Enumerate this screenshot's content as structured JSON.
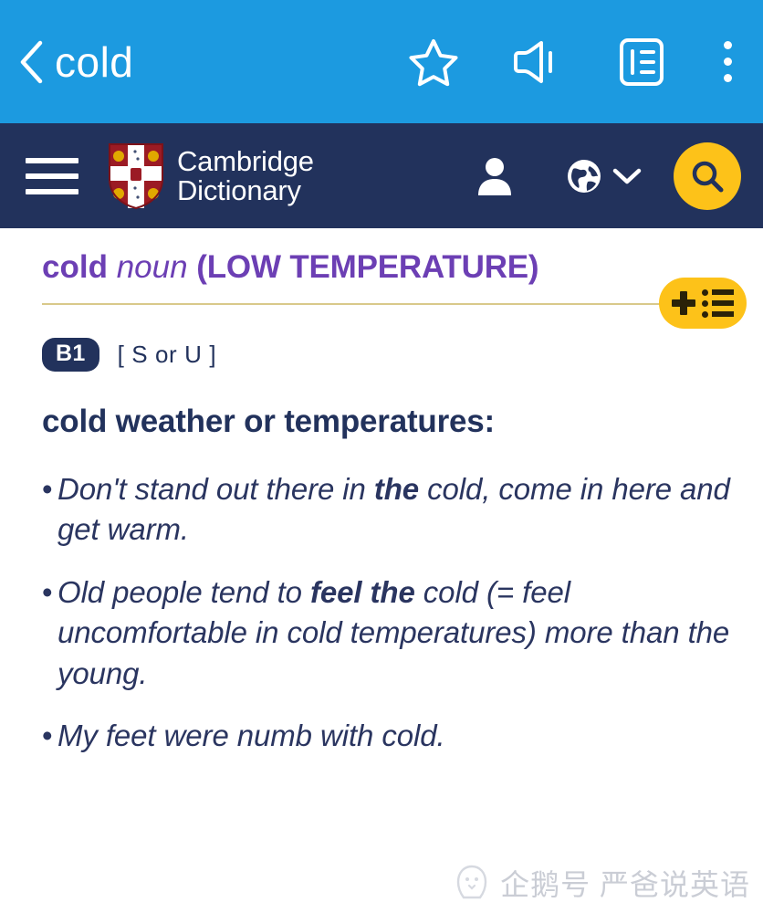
{
  "appbar": {
    "background": "#1c9ae0",
    "back_icon": "chevron-left-icon",
    "title": "cold",
    "icons": [
      {
        "name": "star-icon",
        "label": "Favourite"
      },
      {
        "name": "speaker-icon",
        "label": "Pronounce"
      },
      {
        "name": "article-icon",
        "label": "Article view"
      },
      {
        "name": "more-vertical-icon",
        "label": "More options"
      }
    ]
  },
  "site_header": {
    "background": "#22325c",
    "menu_icon": "hamburger-icon",
    "logo_icon": "cambridge-crest-icon",
    "brand_line1": "Cambridge",
    "brand_line2": "Dictionary",
    "account_icon": "person-icon",
    "language_icon": "globe-icon",
    "language_chevron_icon": "chevron-down-icon",
    "search_icon": "search-icon",
    "search_button_color": "#fdc219"
  },
  "entry": {
    "headword": "cold",
    "part_of_speech": "noun",
    "guide_word": "(LOW TEMPERATURE)",
    "headword_color": "#6c3fb4",
    "add_to_wordlist": {
      "plus_icon": "plus-icon",
      "list_icon": "list-icon",
      "color": "#fdc219"
    },
    "level": "B1",
    "grammar": "[ S or U ]",
    "definition": "cold weather or temperatures:",
    "examples": [
      {
        "bullet": "•",
        "parts": [
          {
            "text": "Don't stand out there in ",
            "bold": false
          },
          {
            "text": "the",
            "bold": true
          },
          {
            "text": " cold, come in here and get warm.",
            "bold": false
          }
        ]
      },
      {
        "bullet": "•",
        "parts": [
          {
            "text": "Old people tend to ",
            "bold": false
          },
          {
            "text": "feel the",
            "bold": true
          },
          {
            "text": " cold (= feel uncomfortable in cold temperatures) more than the young.",
            "bold": false
          }
        ]
      },
      {
        "bullet": "•",
        "parts": [
          {
            "text": "My feet were numb with cold.",
            "bold": false
          }
        ]
      }
    ]
  },
  "watermark": {
    "logo_icon": "penguin-logo-icon",
    "text": "企鹅号 严爸说英语"
  }
}
